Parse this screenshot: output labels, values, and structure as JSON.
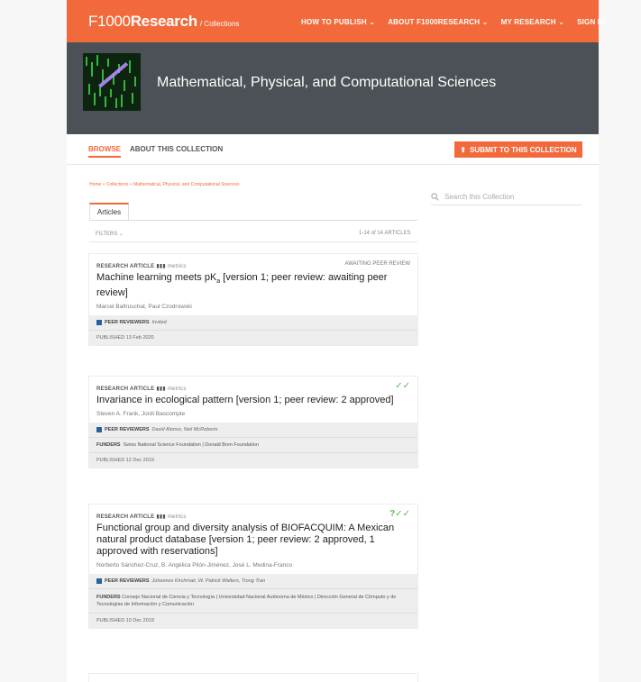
{
  "nav": {
    "logo_main": "F1000",
    "logo_bold": "Research",
    "logo_collection": "/ Collections",
    "links": [
      "HOW TO PUBLISH",
      "ABOUT F1000RESEARCH",
      "MY RESEARCH",
      "SIGN IN"
    ]
  },
  "banner": {
    "title": "Mathematical, Physical, and Computational Sciences"
  },
  "subnav": {
    "browse": "BROWSE",
    "about": "ABOUT THIS COLLECTION",
    "submit": "SUBMIT TO THIS COLLECTION"
  },
  "breadcrumb": {
    "home": "Home",
    "collections": "Collections",
    "current": "Mathematical, Physical, and Computational Sciences"
  },
  "search": {
    "placeholder": "Search this Collection"
  },
  "articles_tab": "Articles",
  "filters_label": "FILTERS",
  "count_label": "1-14 of 14 ARTICLES",
  "articles": [
    {
      "type": "RESEARCH ARTICLE",
      "metrics": "metrics",
      "status": "AWAITING PEER REVIEW",
      "title_pre": "Machine learning meets pK",
      "title_sub": "a",
      "title_post": " [version 1; peer review: awaiting peer review]",
      "authors": "Marcel Baltruschat, Paul Czodrowski",
      "reviewers_label": "PEER REVIEWERS",
      "reviewers": "Invited",
      "published": "PUBLISHED 13 Feb 2020"
    },
    {
      "type": "RESEARCH ARTICLE",
      "metrics": "metrics",
      "checks": "✓✓",
      "title": "Invariance in ecological pattern [version 1; peer review: 2 approved]",
      "authors": "Steven A. Frank, Jordi Bascompte",
      "reviewers_label": "PEER REVIEWERS",
      "reviewers": "David Alonso, Neil McRoberts",
      "funders_label": "FUNDERS",
      "funders": "Swiss National Science Foundation  |  Donald Bren Foundation",
      "published": "PUBLISHED 12 Dec 2019"
    },
    {
      "type": "RESEARCH ARTICLE",
      "metrics": "metrics",
      "checks": "?✓✓",
      "title": "Functional group and diversity analysis of BIOFACQUIM: A Mexican natural product database [version 1; peer review: 2 approved, 1 approved with reservations]",
      "authors": "Norberto Sánchez-Cruz, B. Angélica Pilón-Jiménez, José L. Medina-Franco",
      "reviewers_label": "PEER REVIEWERS",
      "reviewers": "Johannes Kirchmair, W. Patrick Walters, Trong Tran",
      "funders_label": "FUNDERS",
      "funders": "Consejo Nacional de Ciencia y Tecnología  |  Universidad Nacional Autónoma de México  |  Dirección General de Cómputo y de Tecnologías de Información y Comunicación",
      "published": "PUBLISHED 10 Dec 2019"
    }
  ]
}
